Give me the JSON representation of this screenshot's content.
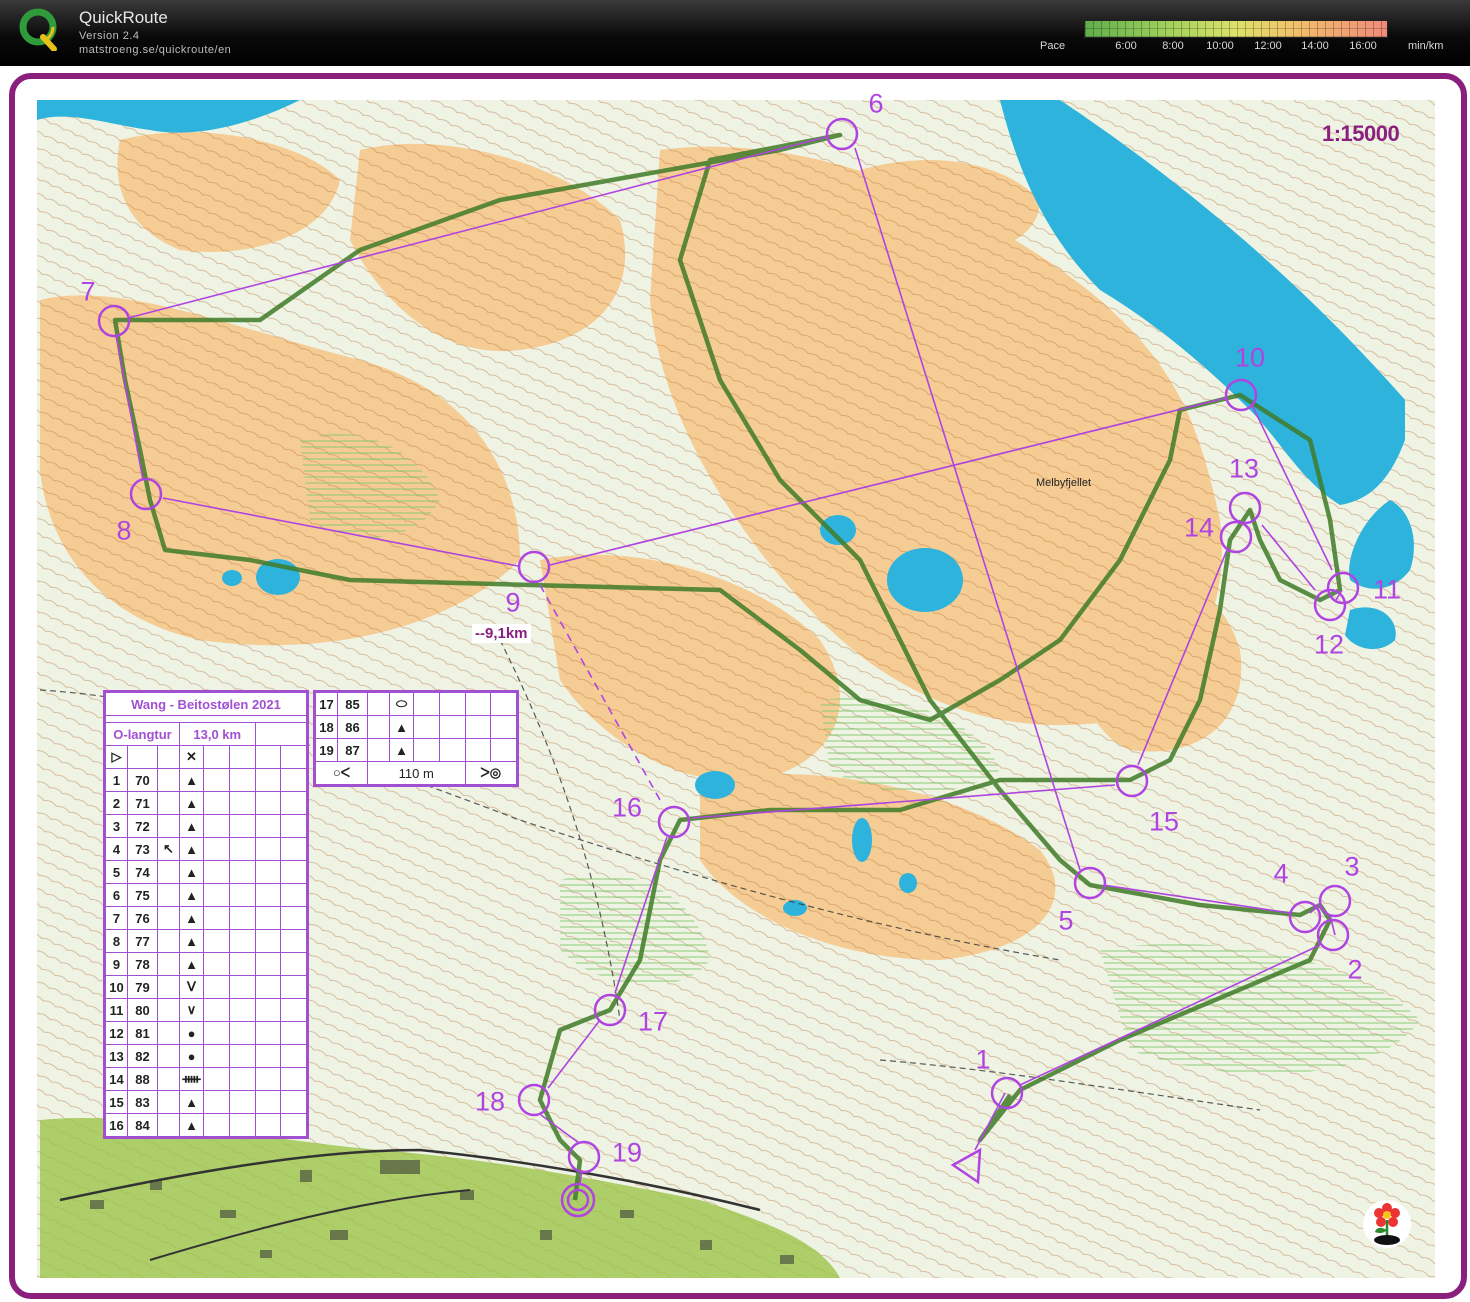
{
  "app": {
    "title": "QuickRoute",
    "version": "Version 2.4",
    "url": "matstroeng.se/quickroute/en"
  },
  "pace_legend": {
    "label": "Pace",
    "ticks": [
      "6:00",
      "8:00",
      "10:00",
      "12:00",
      "14:00",
      "16:00"
    ],
    "unit": "min/km"
  },
  "map": {
    "scale": "1:15000",
    "distance_label": "--9,1km",
    "place_name": "Melbyfjellet",
    "colors": {
      "frame": "#8a1f7d",
      "water": "#2eb3dc",
      "open_land": "#f6c88c",
      "forest": "#e8f0dc",
      "course": "#b044e0",
      "route": "#4a7a2e"
    }
  },
  "controls": [
    "1",
    "2",
    "3",
    "4",
    "5",
    "6",
    "7",
    "8",
    "9",
    "10",
    "11",
    "12",
    "13",
    "14",
    "15",
    "16",
    "17",
    "18",
    "19"
  ],
  "description_sheet": {
    "event": "Wang - Beitostølen 2021",
    "class": "O-langtur",
    "length": "13,0 km",
    "rows_left": [
      {
        "n": "1",
        "code": "70",
        "feature": "triangle-icon",
        "extra": ""
      },
      {
        "n": "2",
        "code": "71",
        "feature": "triangle-icon",
        "extra": ""
      },
      {
        "n": "3",
        "code": "72",
        "feature": "triangle-icon",
        "extra": ""
      },
      {
        "n": "4",
        "code": "73",
        "feature": "triangle-icon",
        "extra": "arrow-nw-icon"
      },
      {
        "n": "5",
        "code": "74",
        "feature": "triangle-icon",
        "extra": ""
      },
      {
        "n": "6",
        "code": "75",
        "feature": "triangle-icon",
        "extra": ""
      },
      {
        "n": "7",
        "code": "76",
        "feature": "triangle-icon",
        "extra": ""
      },
      {
        "n": "8",
        "code": "77",
        "feature": "triangle-icon",
        "extra": ""
      },
      {
        "n": "9",
        "code": "78",
        "feature": "triangle-icon",
        "extra": ""
      },
      {
        "n": "10",
        "code": "79",
        "feature": "pit-icon",
        "extra": ""
      },
      {
        "n": "11",
        "code": "80",
        "feature": "gully-icon",
        "extra": ""
      },
      {
        "n": "12",
        "code": "81",
        "feature": "dot-icon",
        "extra": ""
      },
      {
        "n": "13",
        "code": "82",
        "feature": "dot-icon",
        "extra": ""
      },
      {
        "n": "14",
        "code": "88",
        "feature": "wall-icon",
        "extra": ""
      },
      {
        "n": "15",
        "code": "83",
        "feature": "triangle-icon",
        "extra": ""
      },
      {
        "n": "16",
        "code": "84",
        "feature": "triangle-icon",
        "extra": ""
      }
    ],
    "rows_right": [
      {
        "n": "17",
        "code": "85",
        "feature": "ellipse-icon"
      },
      {
        "n": "18",
        "code": "86",
        "feature": "triangle-icon"
      },
      {
        "n": "19",
        "code": "87",
        "feature": "triangle-icon"
      }
    ],
    "finish_distance": "110 m"
  }
}
